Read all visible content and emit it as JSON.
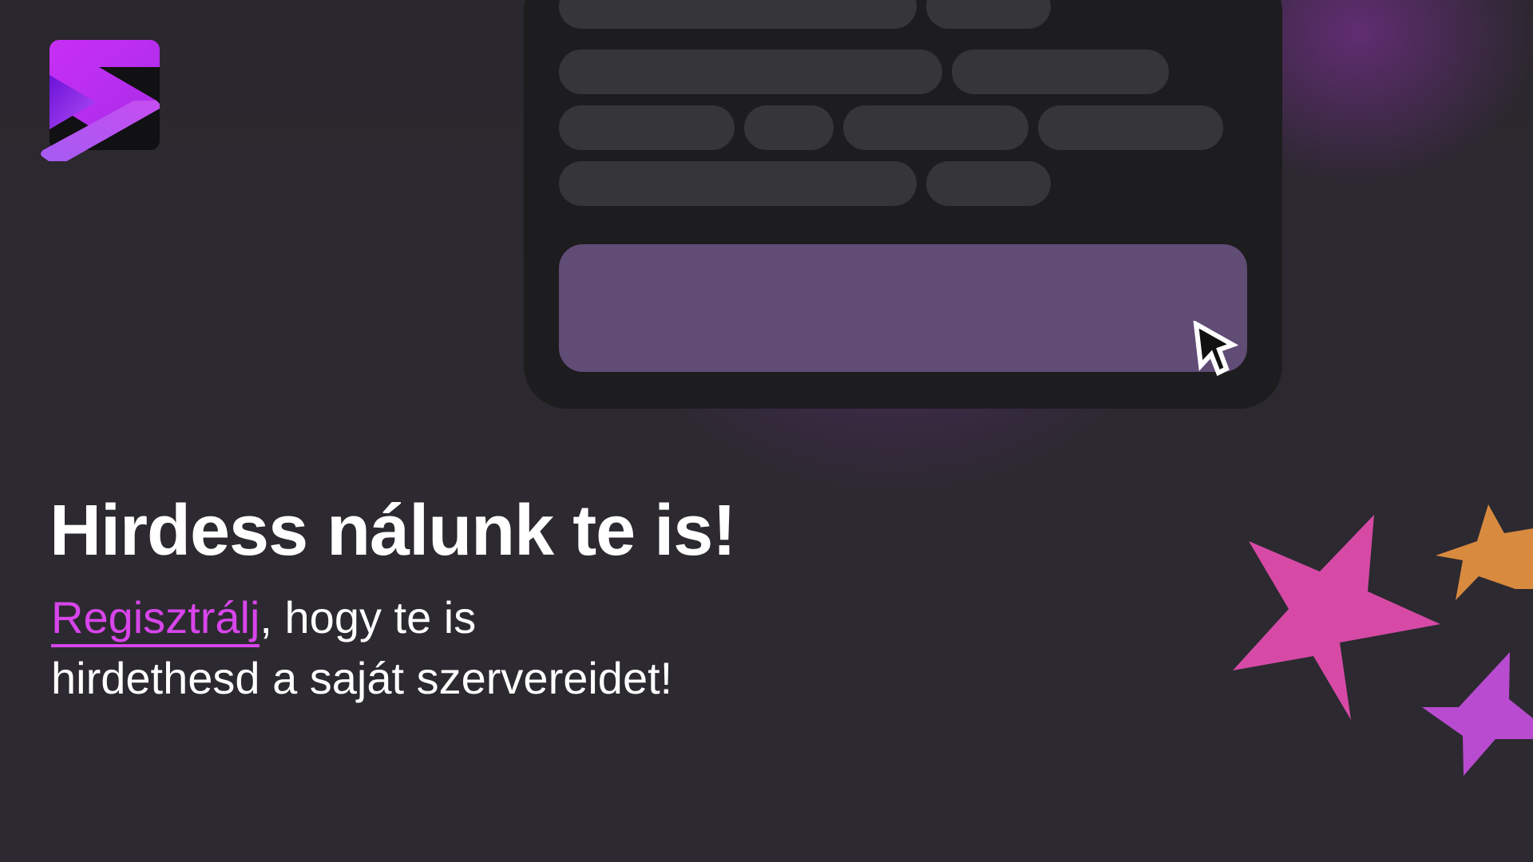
{
  "brand": {
    "logo_icon": "play-s-logo-icon",
    "colors": {
      "primary": "#c132f2",
      "accent_link": "#d745ea",
      "card": "#1d1c1f",
      "placeholder": "#363539",
      "cta_block": "#614c76",
      "background": "#2a272d"
    }
  },
  "preview": {
    "cursor_icon": "mouse-pointer-icon",
    "placeholder_rows": 4
  },
  "hero": {
    "headline": "Hirdess nálunk te is!",
    "register_link": "Regisztrálj",
    "subline_rest_1": ", hogy te is",
    "subline_line_2": "hirdethesd a saját szervereidet!"
  },
  "decor": {
    "stars": [
      {
        "name": "pink-star-icon",
        "color": "#d64aa6"
      },
      {
        "name": "orange-star-icon",
        "color": "#d88a3f"
      },
      {
        "name": "purple-star-icon",
        "color": "#b84bd0"
      }
    ]
  }
}
